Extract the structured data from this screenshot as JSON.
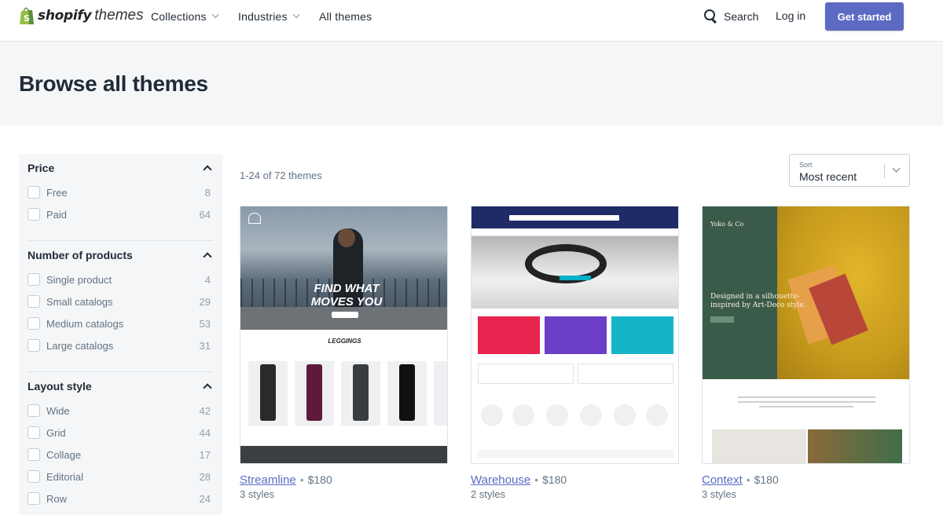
{
  "header": {
    "logo_brand": "shopify",
    "logo_suffix": "themes",
    "nav": [
      {
        "label": "Collections",
        "has_dropdown": true
      },
      {
        "label": "Industries",
        "has_dropdown": true
      },
      {
        "label": "All themes",
        "has_dropdown": false
      }
    ],
    "search_label": "Search",
    "login_label": "Log in",
    "cta_label": "Get started"
  },
  "hero": {
    "title": "Browse all themes"
  },
  "filters": [
    {
      "title": "Price",
      "items": [
        {
          "label": "Free",
          "count": "8"
        },
        {
          "label": "Paid",
          "count": "64"
        }
      ]
    },
    {
      "title": "Number of products",
      "items": [
        {
          "label": "Single product",
          "count": "4"
        },
        {
          "label": "Small catalogs",
          "count": "29"
        },
        {
          "label": "Medium catalogs",
          "count": "53"
        },
        {
          "label": "Large catalogs",
          "count": "31"
        }
      ]
    },
    {
      "title": "Layout style",
      "items": [
        {
          "label": "Wide",
          "count": "42"
        },
        {
          "label": "Grid",
          "count": "44"
        },
        {
          "label": "Collage",
          "count": "17"
        },
        {
          "label": "Editorial",
          "count": "28"
        },
        {
          "label": "Row",
          "count": "24"
        }
      ]
    }
  ],
  "results": {
    "count_text": "1-24 of 72 themes",
    "sort_label": "Sort",
    "sort_value": "Most recent"
  },
  "themes": [
    {
      "name": "Streamline",
      "price": "$180",
      "styles": "3 styles"
    },
    {
      "name": "Warehouse",
      "price": "$180",
      "styles": "2 styles"
    },
    {
      "name": "Context",
      "price": "$180",
      "styles": "3 styles"
    }
  ],
  "thumb_text": {
    "streamline_hero": "FIND WHAT MOVES YOU",
    "streamline_section": "LEGGINGS",
    "context_brand": "Yoko & Co",
    "context_headline": "Designed in a silhouette-inspired by Art-Deco style."
  },
  "colors": {
    "accent": "#5c6ac4",
    "hero_bg": "#f4f6f8",
    "text": "#212b36",
    "muted": "#637381"
  }
}
